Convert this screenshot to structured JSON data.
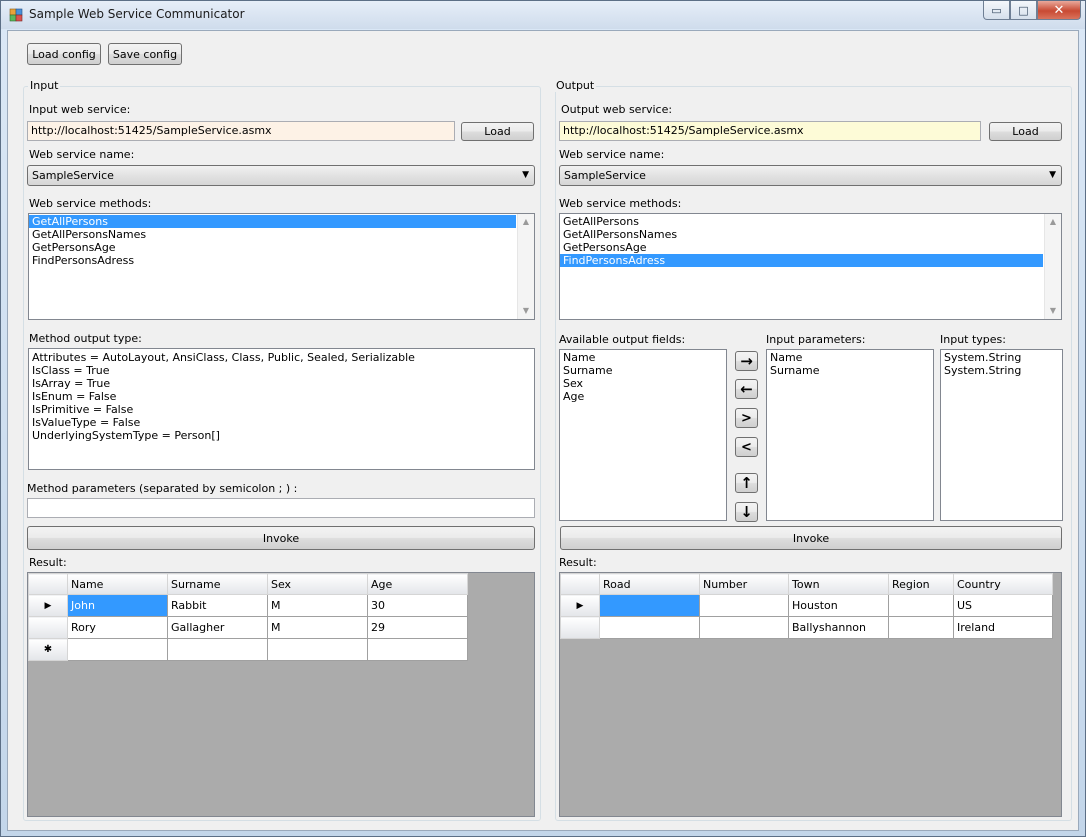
{
  "window": {
    "title": "Sample Web Service Communicator",
    "minimize": "▭",
    "maximize": "□",
    "close": "✕"
  },
  "toolbar": {
    "load_config": "Load config",
    "save_config": "Save config"
  },
  "input": {
    "group_title": "Input",
    "ws_label": "Input web service:",
    "ws_url": "http://localhost:51425/SampleService.asmx",
    "load_label": "Load",
    "name_label": "Web service name:",
    "name_value": "SampleService",
    "methods_label": "Web service methods:",
    "methods": [
      "GetAllPersons",
      "GetAllPersonsNames",
      "GetPersonsAge",
      "FindPersonsAdress"
    ],
    "selected_method": 0,
    "output_type_label": "Method output type:",
    "output_type_lines": [
      "Attributes = AutoLayout, AnsiClass, Class, Public, Sealed, Serializable",
      "IsClass = True",
      "IsArray = True",
      "IsEnum = False",
      "IsPrimitive = False",
      "IsValueType = False",
      "UnderlyingSystemType = Person[]"
    ],
    "params_label": "Method parameters (separated by semicolon ; ) :",
    "params_value": "",
    "invoke_label": "Invoke",
    "result_label": "Result:",
    "grid": {
      "columns": [
        "Name",
        "Surname",
        "Sex",
        "Age"
      ],
      "rows": [
        [
          "John",
          "Rabbit",
          "M",
          "30"
        ],
        [
          "Rory",
          "Gallagher",
          "M",
          "29"
        ]
      ],
      "current_row_marker": "▶",
      "new_row_marker": "✱"
    }
  },
  "output": {
    "group_title": "Output",
    "ws_label": "Output web service:",
    "ws_url": "http://localhost:51425/SampleService.asmx",
    "load_label": "Load",
    "name_label": "Web service name:",
    "name_value": "SampleService",
    "methods_label": "Web service methods:",
    "methods": [
      "GetAllPersons",
      "GetAllPersonsNames",
      "GetPersonsAge",
      "FindPersonsAdress"
    ],
    "selected_method": 3,
    "available_label": "Available output fields:",
    "available_fields": [
      "Name",
      "Surname",
      "Sex",
      "Age"
    ],
    "input_params_label": "Input parameters:",
    "input_params": [
      "Name",
      "Surname"
    ],
    "input_types_label": "Input types:",
    "input_types": [
      "System.String",
      "System.String"
    ],
    "arrow_buttons": {
      "add": "→",
      "remove": "←",
      "add_all": ">",
      "remove_all": "<",
      "move_up": "↑",
      "move_down": "↓"
    },
    "invoke_label": "Invoke",
    "result_label": "Result:",
    "grid": {
      "columns": [
        "Road",
        "Number",
        "Town",
        "Region",
        "Country"
      ],
      "rows": [
        [
          "",
          "",
          "Houston",
          "",
          "US"
        ],
        [
          "",
          "",
          "Ballyshannon",
          "",
          "Ireland"
        ]
      ],
      "current_row_marker": "▶"
    }
  },
  "colors": {
    "input_url_bg": "#fdf2e6",
    "output_url_bg": "#fdfbd7",
    "selection": "#3399ff",
    "grid_bg": "#ababab"
  }
}
